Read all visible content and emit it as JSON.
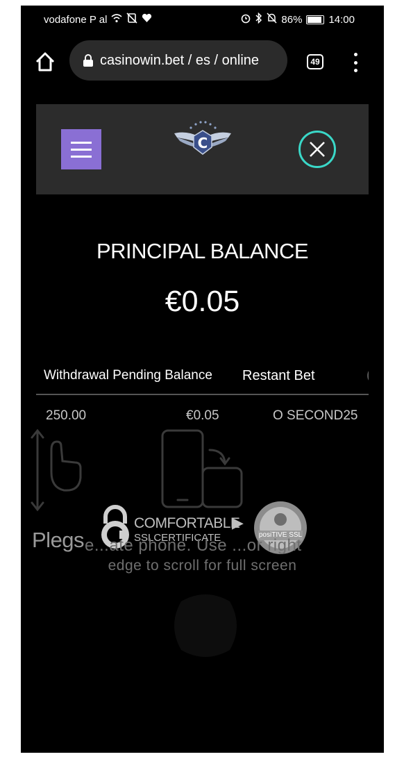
{
  "status_bar": {
    "carrier": "vodafone P al",
    "battery": "86%",
    "time": "14:00"
  },
  "browser": {
    "url": "casinowin.bet / es / online",
    "tab_count": "49"
  },
  "site": {
    "brand_color": "#8a6fd4",
    "close_color": "#3ad8c8"
  },
  "balance": {
    "title": "PRINCIPAL BALANCE",
    "amount": "€0.05"
  },
  "table": {
    "headers": [
      "Withdrawal Pending Balance",
      "Restant Bet"
    ],
    "row": [
      "250.00",
      "€0.05",
      "O SECOND25"
    ]
  },
  "overlay": {
    "badge_line1": "COMFORTABLE",
    "badge_line2": "SSLCERTIFICATE",
    "seal_text": "posiTIVE SSL",
    "plegs": "Plegs",
    "hint_line1": "e...ate phone. Use ...or right",
    "hint_line2": "edge to scroll for full screen"
  }
}
